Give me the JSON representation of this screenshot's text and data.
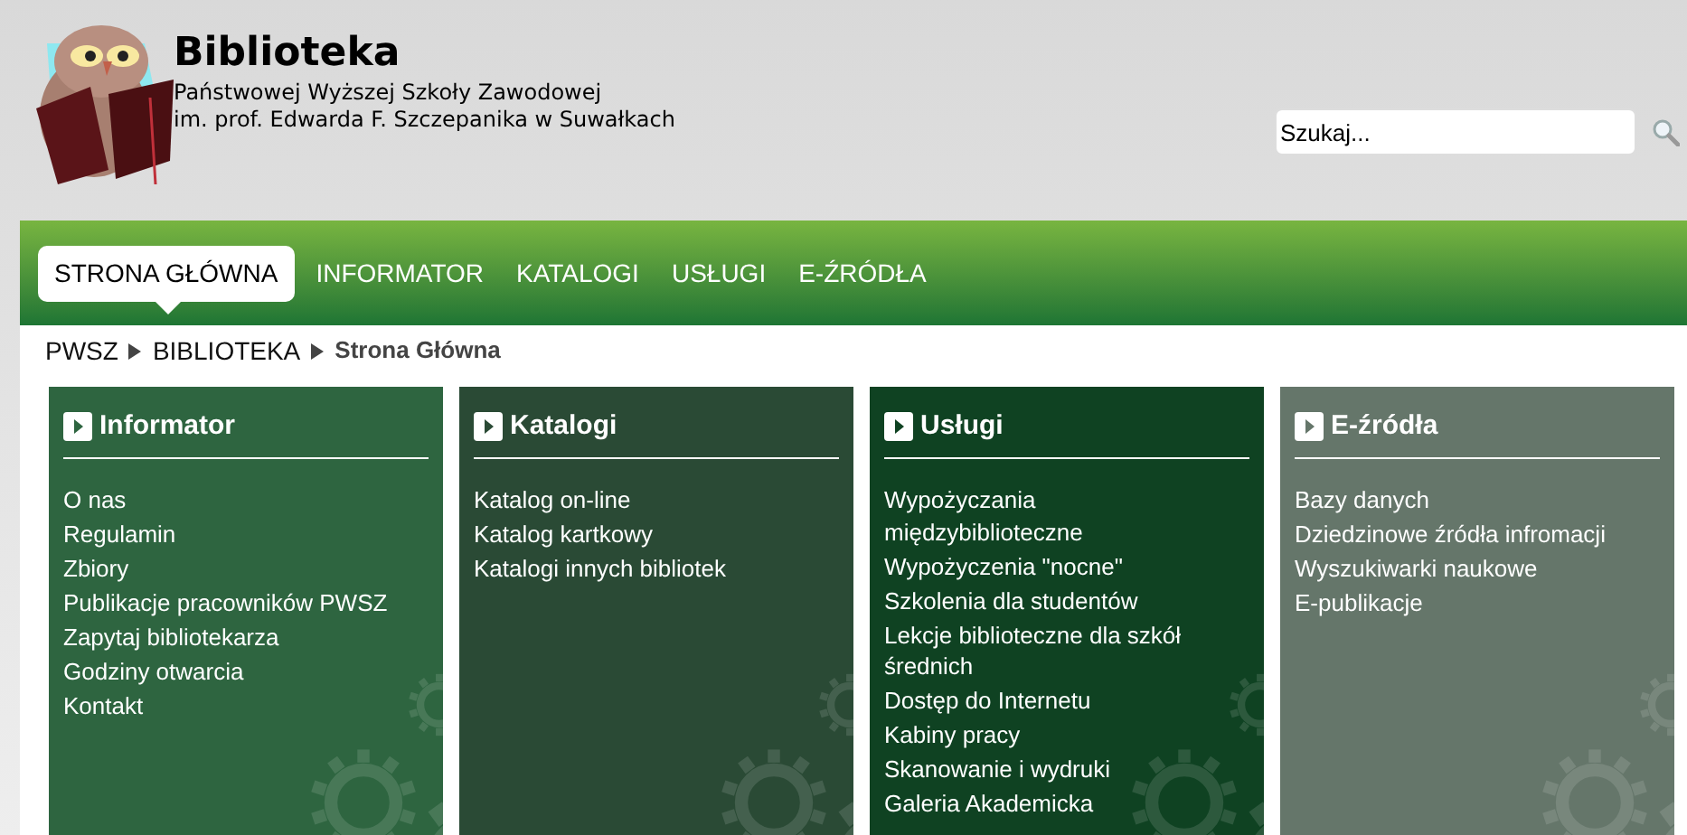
{
  "header": {
    "title": "Biblioteka",
    "subtitle_lines": [
      "Państwowej Wyższej Szkoły Zawodowej",
      "im. prof. Edwarda F. Szczepanika w Suwałkach"
    ]
  },
  "search": {
    "placeholder": "Szukaj..."
  },
  "nav": [
    {
      "label": "STRONA GŁÓWNA",
      "selected": true
    },
    {
      "label": "INFORMATOR",
      "selected": false
    },
    {
      "label": "KATALOGI",
      "selected": false
    },
    {
      "label": "USŁUGI",
      "selected": false
    },
    {
      "label": "E-ŹRÓDŁA",
      "selected": false
    }
  ],
  "breadcrumb": [
    {
      "label": "PWSZ",
      "current": false
    },
    {
      "label": "BIBLIOTEKA",
      "current": false
    },
    {
      "label": "Strona Główna",
      "current": true
    }
  ],
  "panels": [
    {
      "title": "Informator",
      "color": "#2e6540",
      "links": [
        "O nas",
        "Regulamin",
        "Zbiory",
        "Publikacje pracowników PWSZ",
        "Zapytaj bibliotekarza",
        "Godziny otwarcia",
        "Kontakt"
      ]
    },
    {
      "title": "Katalogi",
      "color": "#2a4a35",
      "links": [
        "Katalog on-line",
        "Katalog kartkowy",
        "Katalogi innych bibliotek"
      ]
    },
    {
      "title": "Usługi",
      "color": "#0f4222",
      "links": [
        "Wypożyczania międzybiblioteczne",
        "Wypożyczenia \"nocne\"",
        "Szkolenia dla studentów",
        "Lekcje biblioteczne dla szkół średnich",
        "Dostęp do Internetu",
        "Kabiny pracy",
        "Skanowanie i wydruki",
        "Galeria Akademicka"
      ]
    },
    {
      "title": "E-źródła",
      "color": "#65766a",
      "links": [
        "Bazy danych",
        "Dziedzinowe źródła infromacji",
        "Wyszukiwarki naukowe",
        "E-publikacje"
      ]
    }
  ]
}
